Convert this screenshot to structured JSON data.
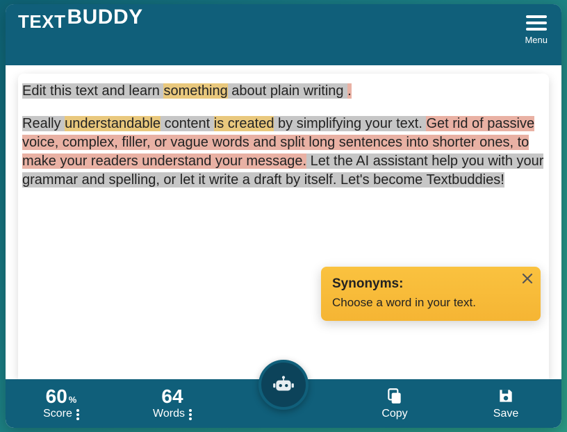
{
  "brand": {
    "text": "TEXT",
    "buddy": "BUDDY"
  },
  "menu": {
    "label": "Menu"
  },
  "editor": {
    "segments": [
      {
        "text": "Edit this text and learn ",
        "class": "hl-grey"
      },
      {
        "text": "something",
        "class": "hl-yellow"
      },
      {
        "text": " about plain writing ",
        "class": "hl-grey"
      },
      {
        "text": ".",
        "class": "hl-pink"
      }
    ],
    "segments2": [
      {
        "text": "Really ",
        "class": "hl-grey"
      },
      {
        "text": "understandable",
        "class": "hl-yellow"
      },
      {
        "text": " content ",
        "class": "hl-grey"
      },
      {
        "text": "is created",
        "class": "hl-yellow"
      },
      {
        "text": " by simplifying your text. ",
        "class": "hl-grey"
      },
      {
        "text": "Get rid of passive voice, complex, filler, or vague words and split long sentences into shorter ones, to make your readers understand your message.",
        "class": "hl-pink"
      },
      {
        "text": " Let the AI assistant help you with your grammar and spelling, or let it write a draft by itself.",
        "class": "hl-grey"
      },
      {
        "text": " Let's become Textbuddies!",
        "class": "hl-grey"
      }
    ]
  },
  "synonyms": {
    "title": "Synonyms:",
    "subtitle": "Choose a word in your text."
  },
  "footer": {
    "score": {
      "value": "60",
      "unit": "%",
      "label": "Score"
    },
    "words": {
      "value": "64",
      "label": "Words"
    },
    "copy": {
      "label": "Copy"
    },
    "save": {
      "label": "Save"
    }
  },
  "icons": {
    "menu": "menu-icon",
    "robot": "robot-icon",
    "copy": "copy-icon",
    "save": "save-icon",
    "close": "close-icon",
    "kebab": "kebab-icon"
  }
}
